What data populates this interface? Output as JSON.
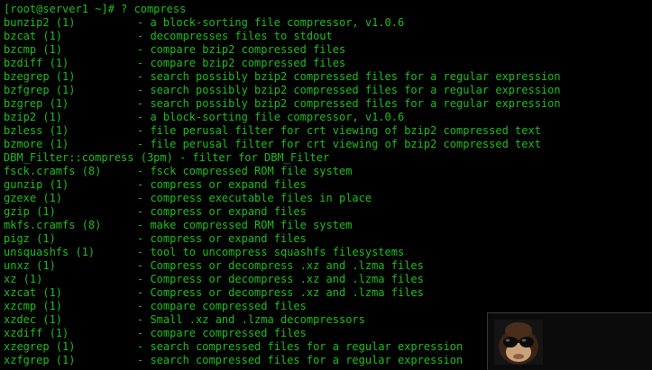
{
  "terminal": {
    "prompt": "[root@server1 ~]# ? compress",
    "entries": [
      {
        "name": "bunzip2 (1)",
        "desc": "- a block-sorting file compressor, v1.0.6"
      },
      {
        "name": "bzcat (1)",
        "desc": "- decompresses files to stdout"
      },
      {
        "name": "bzcmp (1)",
        "desc": "- compare bzip2 compressed files"
      },
      {
        "name": "bzdiff (1)",
        "desc": "- compare bzip2 compressed files"
      },
      {
        "name": "bzegrep (1)",
        "desc": "- search possibly bzip2 compressed files for a regular expression"
      },
      {
        "name": "bzfgrep (1)",
        "desc": "- search possibly bzip2 compressed files for a regular expression"
      },
      {
        "name": "bzgrep (1)",
        "desc": "- search possibly bzip2 compressed files for a regular expression"
      },
      {
        "name": "bzip2 (1)",
        "desc": "- a block-sorting file compressor, v1.0.6"
      },
      {
        "name": "bzless (1)",
        "desc": "- file perusal filter for crt viewing of bzip2 compressed text"
      },
      {
        "name": "bzmore (1)",
        "desc": "- file perusal filter for crt viewing of bzip2 compressed text"
      }
    ],
    "dbm_line": "DBM_Filter::compress (3pm) - filter for DBM_Filter",
    "entries2": [
      {
        "name": "fsck.cramfs (8)",
        "desc": "- fsck compressed ROM file system"
      },
      {
        "name": "gunzip (1)",
        "desc": "- compress or expand files"
      },
      {
        "name": "gzexe (1)",
        "desc": "- compress executable files in place"
      },
      {
        "name": "gzip (1)",
        "desc": "- compress or expand files"
      },
      {
        "name": "mkfs.cramfs (8)",
        "desc": "- make compressed ROM file system"
      },
      {
        "name": "pigz (1)",
        "desc": "- compress or expand files"
      },
      {
        "name": "unsquashfs (1)",
        "desc": "- tool to uncompress squashfs filesystems"
      },
      {
        "name": "unxz (1)",
        "desc": "- Compress or decompress .xz and .lzma files"
      },
      {
        "name": "xz (1)",
        "desc": "- Compress or decompress .xz and .lzma files"
      },
      {
        "name": "xzcat (1)",
        "desc": "- Compress or decompress .xz and .lzma files"
      },
      {
        "name": "xzcmp (1)",
        "desc": "- compare compressed files"
      },
      {
        "name": "xzdec (1)",
        "desc": "- Small .xz and .lzma decompressors"
      },
      {
        "name": "xzdiff (1)",
        "desc": "- compare compressed files"
      },
      {
        "name": "xzegrep (1)",
        "desc": "- search compressed files for a regular expression"
      },
      {
        "name": "xzfgrep (1)",
        "desc": "- search compressed files for a regular expression"
      }
    ]
  },
  "colors": {
    "background": "#000000",
    "text": "#1fbf1f"
  },
  "overlay": {
    "avatar_icon": "monkey-sunglasses-icon"
  }
}
